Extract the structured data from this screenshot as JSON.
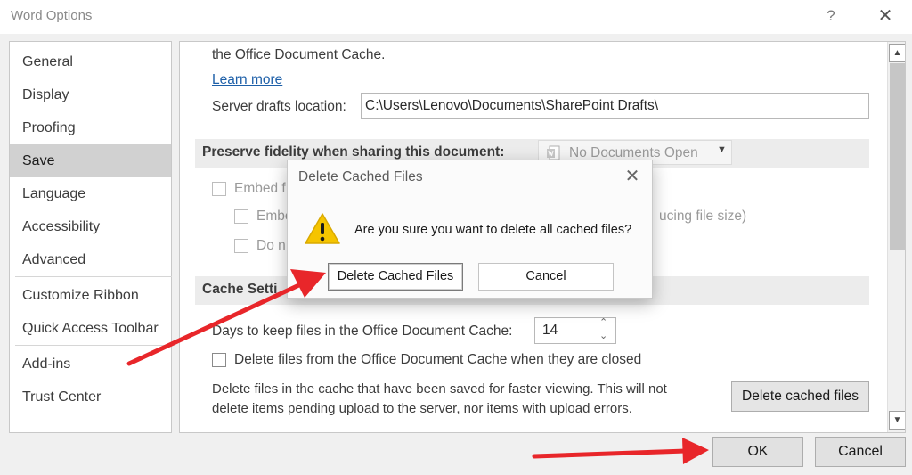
{
  "window": {
    "title": "Word Options",
    "help_label": "?",
    "close_label": "✕"
  },
  "sidebar": {
    "items": [
      {
        "label": "General"
      },
      {
        "label": "Display"
      },
      {
        "label": "Proofing"
      },
      {
        "label": "Save"
      },
      {
        "label": "Language"
      },
      {
        "label": "Accessibility"
      },
      {
        "label": "Advanced"
      },
      {
        "label": "Customize Ribbon"
      },
      {
        "label": "Quick Access Toolbar"
      },
      {
        "label": "Add-ins"
      },
      {
        "label": "Trust Center"
      }
    ],
    "selected": "Save"
  },
  "content": {
    "cache_text_fragment": "the Office Document Cache.",
    "learn_more": "Learn more",
    "server_drafts_label": "Server drafts location:",
    "server_drafts_value": "C:\\Users\\Lenovo\\Documents\\SharePoint Drafts\\",
    "fidelity_title": "Preserve fidelity when sharing this document:",
    "fidelity_dropdown": "No Documents Open",
    "embed_fonts_partial": "Embed f",
    "embed_only_partial": "Embe",
    "do_not_partial": "Do n",
    "reducing_partial": "ucing file size)",
    "cache_settings_title": "Cache Settings",
    "cache_settings_partial": "Cache Setti",
    "days_label": "Days to keep files in the Office Document Cache:",
    "days_value": "14",
    "delete_on_close_label": "Delete files from the Office Document Cache when they are closed",
    "delete_info_line1": "Delete files in the cache that have been saved for faster viewing. This will not",
    "delete_info_line2": "delete items pending upload to the server, nor items with upload errors.",
    "delete_cached_button": "Delete cached files"
  },
  "footer": {
    "ok_label": "OK",
    "cancel_label": "Cancel"
  },
  "dialog": {
    "title": "Delete Cached Files",
    "message": "Are you sure you want to delete all cached files?",
    "confirm_label": "Delete Cached Files",
    "cancel_label": "Cancel",
    "close_label": "✕"
  },
  "colors": {
    "annotation_arrow": "#e8262a",
    "warning_icon": "#f5c400"
  }
}
